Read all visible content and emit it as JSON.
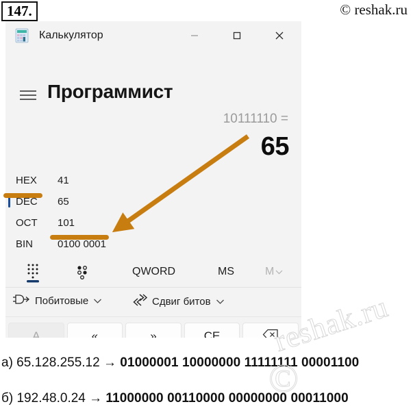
{
  "page": {
    "exercise_number": "147.",
    "watermark_top": "© reshak.ru",
    "watermark_big": "reshak.ru",
    "watermark_c": "©"
  },
  "colors": {
    "accent_orange": "#c87d11",
    "selection_blue": "#1b4e9b",
    "window_bg": "#f3f3f3",
    "text": "#1d1d1d"
  },
  "window": {
    "app_icon": "calculator-icon",
    "title": "Калькулятор",
    "controls": {
      "minimize": "minimize-icon",
      "maximize": "maximize-icon",
      "close": "close-icon"
    }
  },
  "header": {
    "menu_icon": "hamburger-menu-icon",
    "mode_title": "Программист"
  },
  "display": {
    "expression": "10111110 =",
    "result": "65"
  },
  "radix_rows": [
    {
      "label": "HEX",
      "value": "41",
      "selected": false
    },
    {
      "label": "DEC",
      "value": "65",
      "selected": true
    },
    {
      "label": "OCT",
      "value": "101",
      "selected": false
    },
    {
      "label": "BIN",
      "value": "0100 0001",
      "selected": false
    }
  ],
  "mem_toolbar": {
    "keypad_toggle_icon": "keypad-icon",
    "bit_toggle_icon": "bit-toggle-icon",
    "word_size": "QWORD",
    "memory_store": "MS",
    "memory_dropdown": "M"
  },
  "operator_bar": {
    "bitwise": {
      "icon": "logic-gate-icon",
      "label": "Побитовые",
      "chevron": "chevron-down-icon"
    },
    "bitshift": {
      "icon": "bit-shift-icon",
      "label": "Сдвиг битов",
      "chevron": "chevron-down-icon"
    }
  },
  "keys": [
    {
      "label": "A",
      "disabled": true,
      "icon": null
    },
    {
      "label": "«",
      "disabled": false,
      "icon": null
    },
    {
      "label": "»",
      "disabled": false,
      "icon": null
    },
    {
      "label": "CE",
      "disabled": false,
      "icon": null
    },
    {
      "label": "",
      "disabled": false,
      "icon": "backspace-icon"
    }
  ],
  "answers": [
    {
      "prefix": "а) 65.128.255.12 → ",
      "bits": "01000001 10000000 11111111 00001100"
    },
    {
      "prefix": "б) 192.48.0.24 → ",
      "bits": "11000000 00110000 00000000 00011000"
    }
  ]
}
